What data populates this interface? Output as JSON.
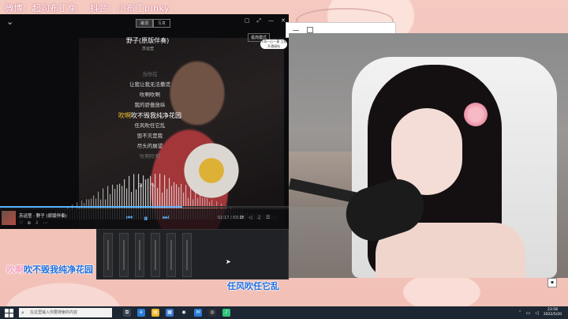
{
  "watermark": {
    "weibo": "微博：起司布丁兔",
    "douyin": "抖音：小布丁pinky"
  },
  "player": {
    "mode_tabs": [
      "歌词",
      "写真"
    ],
    "window_controls": [
      "▢",
      "⤢",
      "—",
      "✕"
    ],
    "mini_button": "极简模式",
    "song_title": "野子(原版伴奏)",
    "artist": "苏运莹",
    "pill_text": "小风一心一意 立即开通绿钻",
    "lyrics": [
      {
        "text": "当你在",
        "state": "dim"
      },
      {
        "text": "让我让我无法撒谎",
        "state": "normal"
      },
      {
        "text": "吹啊吹啊",
        "state": "normal"
      },
      {
        "text": "我的骄傲放纵",
        "state": "normal"
      },
      {
        "pre": "吹啊",
        "text": "吹不毁我纯净花园",
        "state": "active"
      },
      {
        "text": "任风吹任它乱",
        "state": "normal"
      },
      {
        "text": "毁不灭是我",
        "state": "normal"
      },
      {
        "text": "尽头的展望",
        "state": "normal"
      },
      {
        "text": "吹啊吹啊",
        "state": "dim"
      }
    ],
    "lyric_tools": [
      "⊟",
      "✎"
    ],
    "now_playing": "苏运莹 · 野子 (原版伴奏)",
    "now_playing_icons": [
      "♡",
      "⊕",
      "⇩",
      "⋯"
    ],
    "time": "02:17 / 03:22",
    "right_icons": [
      "⟳",
      "◁",
      "♫",
      "☰"
    ],
    "progress": 0.63,
    "controls": {
      "prev": "⏮",
      "play": "⏸",
      "next": "⏭"
    }
  },
  "mixer": {
    "channel_count": 6
  },
  "overlay": {
    "line1_pre": "吹啊",
    "line1": "吹不毁我纯净花园",
    "line2": "任风吹任它乱"
  },
  "taskbar": {
    "search_placeholder": "在这里输入你要搜索的内容",
    "search_icon": "search-icon",
    "apps": [
      {
        "name": "task-view-icon",
        "glyph": "⧉",
        "color": "#3b4756"
      },
      {
        "name": "edge-icon",
        "glyph": "e",
        "color": "#2b7cd3"
      },
      {
        "name": "explorer-icon",
        "glyph": "▤",
        "color": "#f0b429"
      },
      {
        "name": "store-icon",
        "glyph": "▦",
        "color": "#3a7bd5"
      },
      {
        "name": "steam-icon",
        "glyph": "◉",
        "color": "#1b2838"
      },
      {
        "name": "mail-icon",
        "glyph": "✉",
        "color": "#2b7cd3"
      },
      {
        "name": "obs-icon",
        "glyph": "◎",
        "color": "#302e31"
      },
      {
        "name": "qqmusic-icon",
        "glyph": "♪",
        "color": "#31c27c"
      }
    ],
    "clock_time": "23:58",
    "clock_date": "2022/5/20"
  }
}
